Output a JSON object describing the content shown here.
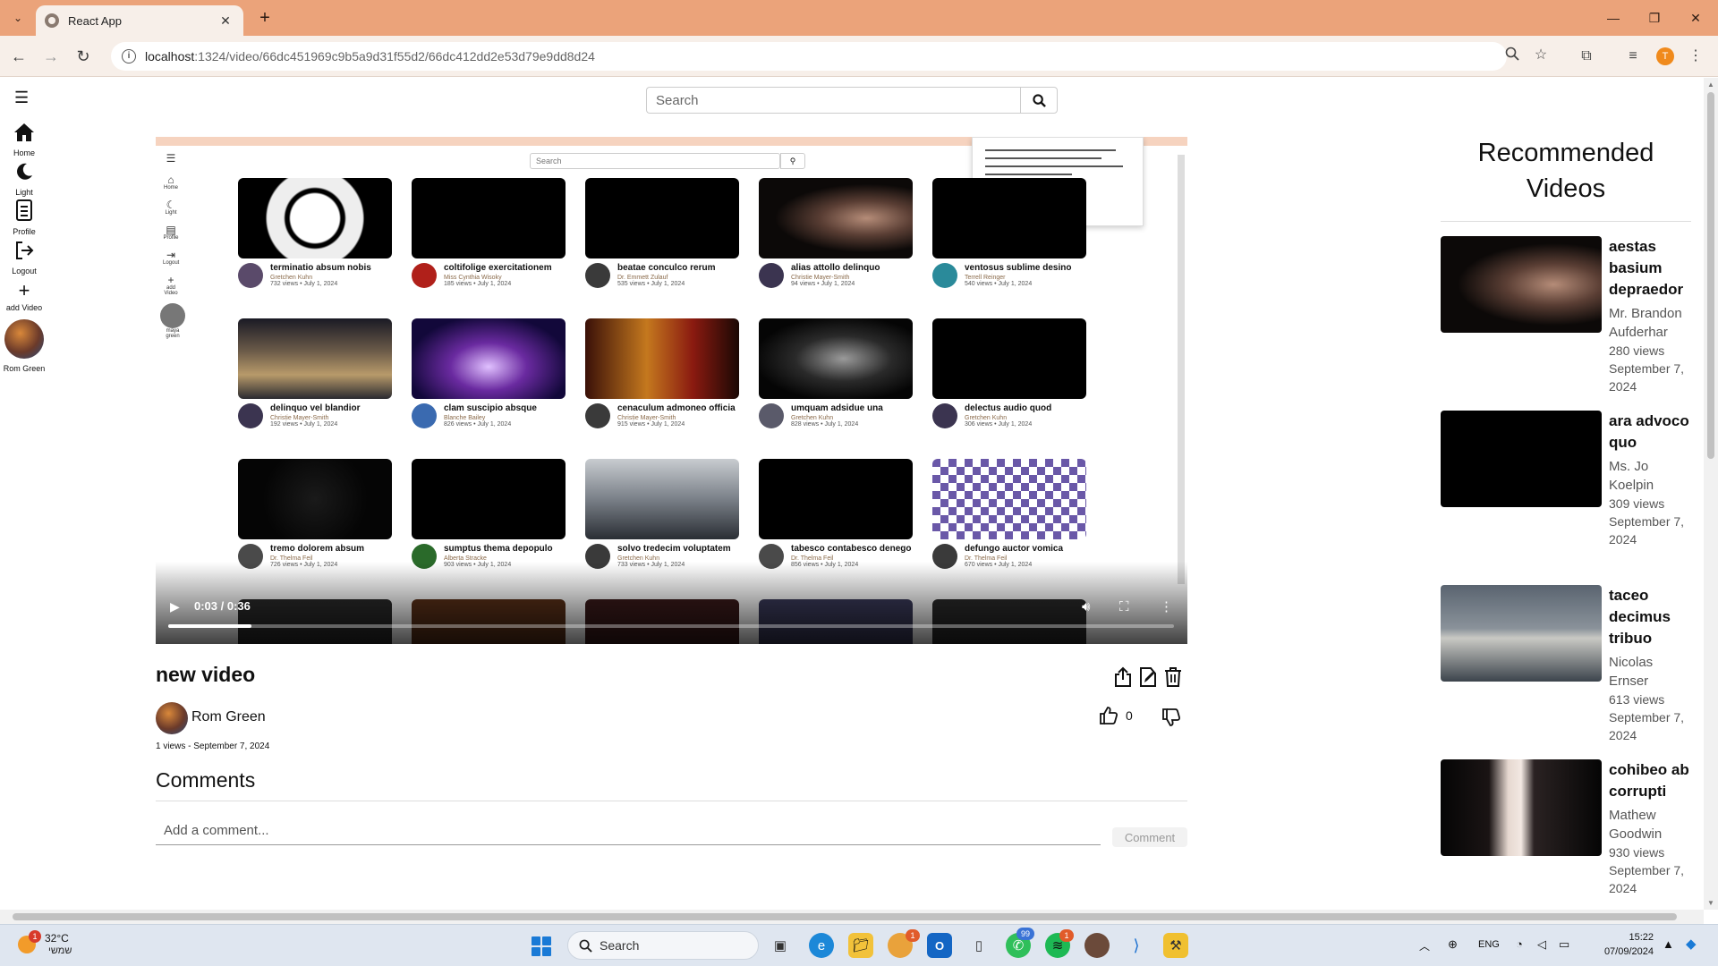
{
  "browser": {
    "tab_title": "React App",
    "url_host": "localhost",
    "url_rest": ":1324/video/66dc451969c9b5a9d31f55d2/66dc412dd2e53d79e9dd8d24",
    "profile_initial": "T"
  },
  "sidebar": {
    "items": [
      {
        "label": "Home",
        "icon": "home-icon"
      },
      {
        "label": "Light",
        "icon": "moon-icon"
      },
      {
        "label": "Profile",
        "icon": "profile-icon"
      },
      {
        "label": "Logout",
        "icon": "logout-icon"
      },
      {
        "label": "add Video",
        "icon": "plus-icon"
      }
    ],
    "user_name": "Rom Green"
  },
  "search": {
    "placeholder": "Search"
  },
  "player": {
    "time": "0:03 / 0:36",
    "progress": 0.083,
    "screen": {
      "search_placeholder": "Search",
      "nav": [
        "Home",
        "Light",
        "Profile",
        "Logout",
        "add Video",
        "maya",
        "green"
      ],
      "cards": [
        {
          "title": "terminatio absum nobis",
          "author": "Gretchen Kuhn",
          "views": "732 views • July 1, 2024"
        },
        {
          "title": "coltifolige exercitationem",
          "author": "Miss Cynthia Wisoky",
          "views": "185 views • July 1, 2024"
        },
        {
          "title": "beatae conculco rerum",
          "author": "Dr. Emmett Zulauf",
          "views": "535 views • July 1, 2024"
        },
        {
          "title": "alias attollo delinquo",
          "author": "Christie Mayer-Smith",
          "views": "94 views • July 1, 2024"
        },
        {
          "title": "ventosus sublime desino",
          "author": "Terrell Reinger",
          "views": "540 views • July 1, 2024"
        },
        {
          "title": "delinquo vel blandior",
          "author": "Christie Mayer-Smith",
          "views": "192 views • July 1, 2024"
        },
        {
          "title": "clam suscipio absque",
          "author": "Blanche Bailey",
          "views": "826 views • July 1, 2024"
        },
        {
          "title": "cenaculum admoneo officia",
          "author": "Christie Mayer-Smith",
          "views": "915 views • July 1, 2024"
        },
        {
          "title": "umquam adsidue una",
          "author": "Gretchen Kuhn",
          "views": "828 views • July 1, 2024"
        },
        {
          "title": "delectus audio quod",
          "author": "Gretchen Kuhn",
          "views": "306 views • July 1, 2024"
        },
        {
          "title": "tremo dolorem absum",
          "author": "Dr. Thelma Feil",
          "views": "726 views • July 1, 2024"
        },
        {
          "title": "sumptus thema depopulo",
          "author": "Alberta Stracke",
          "views": "903 views • July 1, 2024"
        },
        {
          "title": "solvo tredecim voluptatem",
          "author": "Gretchen Kuhn",
          "views": "733 views • July 1, 2024"
        },
        {
          "title": "tabesco contabesco denego",
          "author": "Dr. Thelma Feil",
          "views": "856 views • July 1, 2024"
        },
        {
          "title": "defungo auctor vomica",
          "author": "Dr. Thelma Feil",
          "views": "670 views • July 1, 2024"
        }
      ]
    }
  },
  "video": {
    "title": "new video",
    "channel": "Rom Green",
    "likes": "0",
    "views_date": "1 views - September 7, 2024"
  },
  "comments": {
    "heading": "Comments",
    "placeholder": "Add a comment...",
    "button": "Comment"
  },
  "recommended": {
    "heading": "Recommended Videos",
    "items": [
      {
        "title": "aestas basium depraedor",
        "author": "Mr. Brandon Aufderhar",
        "views": "280 views",
        "date": "September 7, 2024"
      },
      {
        "title": "ara advoco quo",
        "author": "Ms. Jo Koelpin",
        "views": "309 views",
        "date": "September 7, 2024"
      },
      {
        "title": "taceo decimus tribuo",
        "author": "Nicolas Ernser",
        "views": "613 views",
        "date": "September 7, 2024"
      },
      {
        "title": "cohibeo ab corrupti",
        "author": "Mathew Goodwin",
        "views": "930 views",
        "date": "September 7, 2024"
      }
    ]
  },
  "taskbar": {
    "temperature": "32°C",
    "weather_desc": "שמשי",
    "weather_badge": "1",
    "search_label": "Search",
    "language": "ENG",
    "time": "15:22",
    "date": "07/09/2024",
    "badges": {
      "chrome": "1",
      "whatsapp": "99",
      "spotify": "1"
    }
  },
  "colors": {
    "accent_tabbar": "#eba37a",
    "toolbar": "#f7efe9",
    "profile": "#f08a1c"
  }
}
